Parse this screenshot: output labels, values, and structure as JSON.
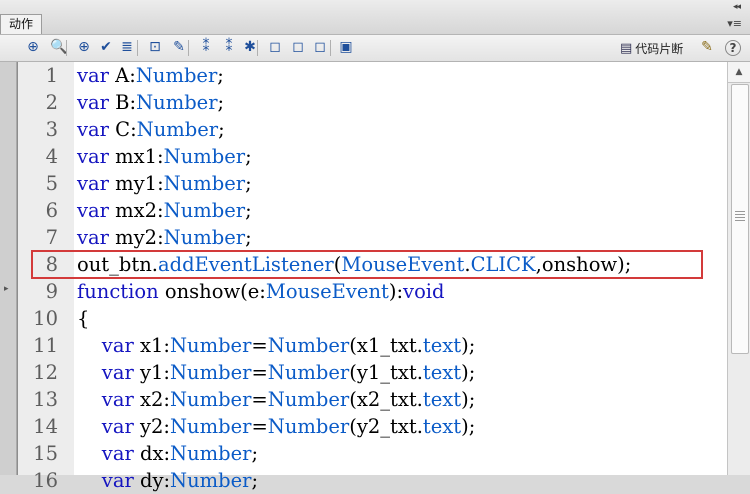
{
  "panel": {
    "tab_label": "动作",
    "collapse_glyph": "◂◂",
    "menu_glyph": "▾≡"
  },
  "toolbar": {
    "icons": [
      {
        "name": "add-script-item-icon",
        "glyph": "⊕"
      },
      {
        "name": "find-icon",
        "glyph": "🔍"
      },
      {
        "name": "insert-target-path-icon",
        "glyph": "⊕"
      },
      {
        "name": "check-syntax-icon",
        "glyph": "✔"
      },
      {
        "name": "auto-format-icon",
        "glyph": "≣"
      },
      {
        "name": "show-code-hint-icon",
        "glyph": "⊡"
      },
      {
        "name": "debug-options-icon",
        "glyph": "✎"
      },
      {
        "name": "collapse-between-braces-icon",
        "glyph": "⁑"
      },
      {
        "name": "collapse-selection-icon",
        "glyph": "⁑"
      },
      {
        "name": "expand-all-icon",
        "glyph": "✱"
      },
      {
        "name": "apply-block-comment-icon",
        "glyph": "◻"
      },
      {
        "name": "apply-line-comment-icon",
        "glyph": "◻"
      },
      {
        "name": "remove-comment-icon",
        "glyph": "◻"
      },
      {
        "name": "toggle-toolbox-icon",
        "glyph": "▣"
      }
    ],
    "snippets_label": "代码片断",
    "wand_glyph": "✎",
    "help_glyph": "?"
  },
  "code_lines": [
    {
      "n": "1",
      "parts": [
        {
          "t": "var",
          "c": "kw"
        },
        {
          "t": " A:",
          "c": "nm"
        },
        {
          "t": "Number",
          "c": "ty"
        },
        {
          "t": ";",
          "c": "nm"
        }
      ]
    },
    {
      "n": "2",
      "parts": [
        {
          "t": "var",
          "c": "kw"
        },
        {
          "t": " B:",
          "c": "nm"
        },
        {
          "t": "Number",
          "c": "ty"
        },
        {
          "t": ";",
          "c": "nm"
        }
      ]
    },
    {
      "n": "3",
      "parts": [
        {
          "t": "var",
          "c": "kw"
        },
        {
          "t": " C:",
          "c": "nm"
        },
        {
          "t": "Number",
          "c": "ty"
        },
        {
          "t": ";",
          "c": "nm"
        }
      ]
    },
    {
      "n": "4",
      "parts": [
        {
          "t": "var",
          "c": "kw"
        },
        {
          "t": " mx1:",
          "c": "nm"
        },
        {
          "t": "Number",
          "c": "ty"
        },
        {
          "t": ";",
          "c": "nm"
        }
      ]
    },
    {
      "n": "5",
      "parts": [
        {
          "t": "var",
          "c": "kw"
        },
        {
          "t": " my1:",
          "c": "nm"
        },
        {
          "t": "Number",
          "c": "ty"
        },
        {
          "t": ";",
          "c": "nm"
        }
      ]
    },
    {
      "n": "6",
      "parts": [
        {
          "t": "var",
          "c": "kw"
        },
        {
          "t": " mx2:",
          "c": "nm"
        },
        {
          "t": "Number",
          "c": "ty"
        },
        {
          "t": ";",
          "c": "nm"
        }
      ]
    },
    {
      "n": "7",
      "parts": [
        {
          "t": "var",
          "c": "kw"
        },
        {
          "t": " my2:",
          "c": "nm"
        },
        {
          "t": "Number",
          "c": "ty"
        },
        {
          "t": ";",
          "c": "nm"
        }
      ]
    },
    {
      "n": "8",
      "parts": [
        {
          "t": "out_btn.",
          "c": "nm"
        },
        {
          "t": "addEventListener",
          "c": "ty"
        },
        {
          "t": "(",
          "c": "nm"
        },
        {
          "t": "MouseEvent",
          "c": "ty"
        },
        {
          "t": ".",
          "c": "nm"
        },
        {
          "t": "CLICK",
          "c": "ty"
        },
        {
          "t": ",onshow);",
          "c": "nm"
        }
      ]
    },
    {
      "n": "9",
      "parts": [
        {
          "t": "function",
          "c": "kw"
        },
        {
          "t": " onshow(e:",
          "c": "nm"
        },
        {
          "t": "MouseEvent",
          "c": "ty"
        },
        {
          "t": "):",
          "c": "nm"
        },
        {
          "t": "void",
          "c": "kw"
        }
      ]
    },
    {
      "n": "10",
      "parts": [
        {
          "t": "{",
          "c": "nm"
        }
      ]
    },
    {
      "n": "11",
      "parts": [
        {
          "t": "    ",
          "c": "nm"
        },
        {
          "t": "var",
          "c": "kw"
        },
        {
          "t": " x1:",
          "c": "nm"
        },
        {
          "t": "Number",
          "c": "ty"
        },
        {
          "t": "=",
          "c": "nm"
        },
        {
          "t": "Number",
          "c": "ty"
        },
        {
          "t": "(x1_txt.",
          "c": "nm"
        },
        {
          "t": "text",
          "c": "ty"
        },
        {
          "t": ");",
          "c": "nm"
        }
      ]
    },
    {
      "n": "12",
      "parts": [
        {
          "t": "    ",
          "c": "nm"
        },
        {
          "t": "var",
          "c": "kw"
        },
        {
          "t": " y1:",
          "c": "nm"
        },
        {
          "t": "Number",
          "c": "ty"
        },
        {
          "t": "=",
          "c": "nm"
        },
        {
          "t": "Number",
          "c": "ty"
        },
        {
          "t": "(y1_txt.",
          "c": "nm"
        },
        {
          "t": "text",
          "c": "ty"
        },
        {
          "t": ");",
          "c": "nm"
        }
      ]
    },
    {
      "n": "13",
      "parts": [
        {
          "t": "    ",
          "c": "nm"
        },
        {
          "t": "var",
          "c": "kw"
        },
        {
          "t": " x2:",
          "c": "nm"
        },
        {
          "t": "Number",
          "c": "ty"
        },
        {
          "t": "=",
          "c": "nm"
        },
        {
          "t": "Number",
          "c": "ty"
        },
        {
          "t": "(x2_txt.",
          "c": "nm"
        },
        {
          "t": "text",
          "c": "ty"
        },
        {
          "t": ");",
          "c": "nm"
        }
      ]
    },
    {
      "n": "14",
      "parts": [
        {
          "t": "    ",
          "c": "nm"
        },
        {
          "t": "var",
          "c": "kw"
        },
        {
          "t": " y2:",
          "c": "nm"
        },
        {
          "t": "Number",
          "c": "ty"
        },
        {
          "t": "=",
          "c": "nm"
        },
        {
          "t": "Number",
          "c": "ty"
        },
        {
          "t": "(y2_txt.",
          "c": "nm"
        },
        {
          "t": "text",
          "c": "ty"
        },
        {
          "t": ");",
          "c": "nm"
        }
      ]
    },
    {
      "n": "15",
      "parts": [
        {
          "t": "    ",
          "c": "nm"
        },
        {
          "t": "var",
          "c": "kw"
        },
        {
          "t": " dx:",
          "c": "nm"
        },
        {
          "t": "Number",
          "c": "ty"
        },
        {
          "t": ";",
          "c": "nm"
        }
      ]
    },
    {
      "n": "16",
      "parts": [
        {
          "t": "    ",
          "c": "nm"
        },
        {
          "t": "var",
          "c": "kw"
        },
        {
          "t": " dy:",
          "c": "nm"
        },
        {
          "t": "Number",
          "c": "ty"
        },
        {
          "t": ";",
          "c": "nm"
        }
      ]
    }
  ],
  "highlight": {
    "line": "8",
    "color": "#d33a3a"
  },
  "colors": {
    "keyword": "#1515c0",
    "type": "#0b5bc7",
    "plain": "#000000"
  }
}
